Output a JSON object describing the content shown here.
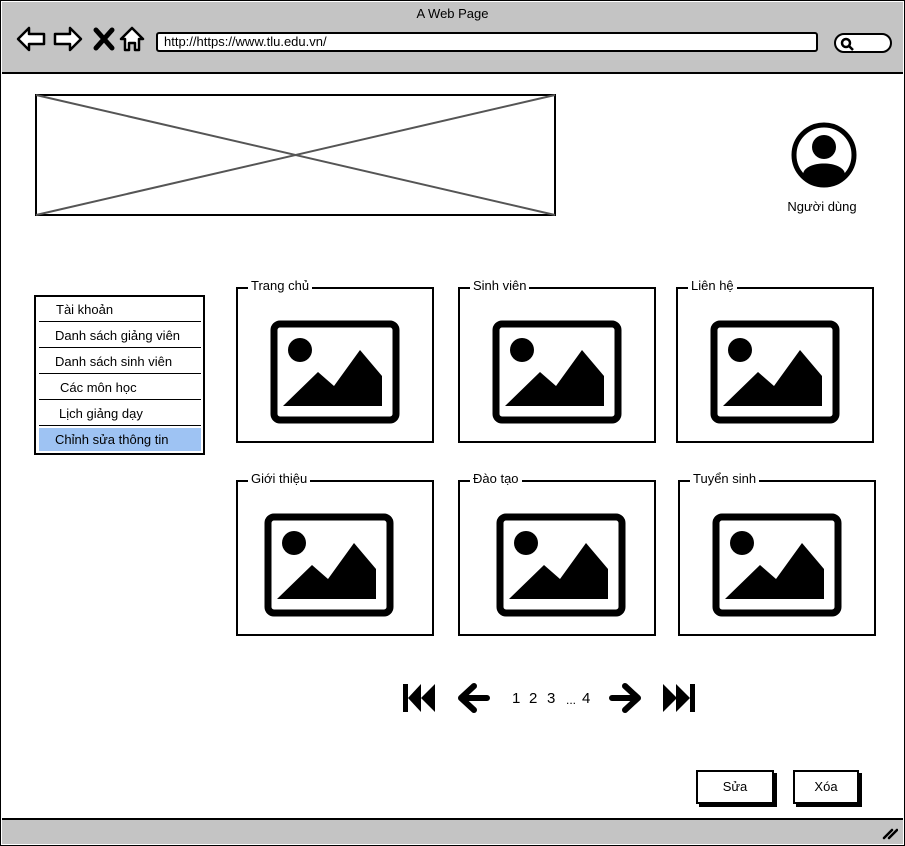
{
  "window": {
    "title": "A Web Page"
  },
  "browser": {
    "url": "http://https://www.tlu.edu.vn/",
    "nav_icons": [
      "back-arrow-icon",
      "forward-arrow-icon",
      "close-icon",
      "home-icon",
      "search-icon"
    ]
  },
  "header": {
    "banner_icon": "image-placeholder-icon",
    "user_icon": "user-avatar-icon",
    "user_label": "Người dùng"
  },
  "sidebar": {
    "items": [
      {
        "label": "Tài khoản"
      },
      {
        "label": "Danh sách giảng viên"
      },
      {
        "label": "Danh sách sinh viên"
      },
      {
        "label": "Các môn học"
      },
      {
        "label": "Lịch giảng dạy"
      },
      {
        "label": "Chỉnh sửa thông tin",
        "selected": true
      }
    ],
    "selected_color": "#9ec3f3"
  },
  "cards": [
    {
      "label": "Trang chủ",
      "icon": "image-icon"
    },
    {
      "label": "Sinh viên",
      "icon": "image-icon"
    },
    {
      "label": "Liên hệ",
      "icon": "image-icon"
    },
    {
      "label": "Giới thiệu",
      "icon": "image-icon"
    },
    {
      "label": "Đào tạo",
      "icon": "image-icon"
    },
    {
      "label": "Tuyển sinh",
      "icon": "image-icon"
    }
  ],
  "pagination": {
    "pages": [
      "1",
      "2",
      "3"
    ],
    "ellipsis": "...",
    "last_page": "4",
    "icons": [
      "first-page-icon",
      "prev-page-icon",
      "next-page-icon",
      "last-page-icon"
    ]
  },
  "actions": {
    "edit_label": "Sửa",
    "delete_label": "Xóa"
  },
  "colors": {
    "chrome": "#c4c4c4",
    "border": "#000000",
    "highlight": "#9ec3f3"
  }
}
